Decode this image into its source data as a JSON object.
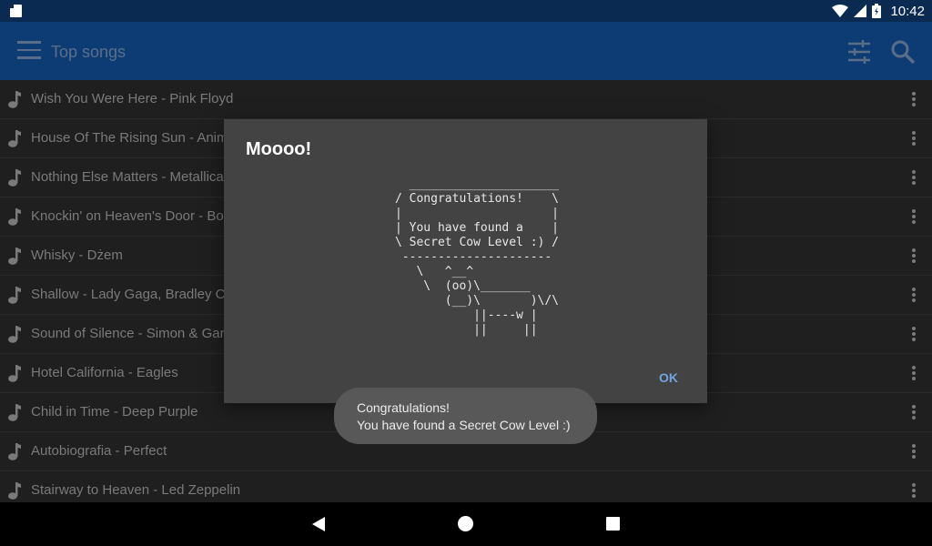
{
  "status_bar": {
    "time": "10:42"
  },
  "app_bar": {
    "title": "Top songs"
  },
  "songs": [
    "Wish You Were Here - Pink Floyd",
    "House Of The Rising Sun - Animals",
    "Nothing Else Matters - Metallica",
    "Knockin' on Heaven's Door - Bob Dylan",
    "Whisky - Dżem",
    "Shallow - Lady Gaga, Bradley Cooper",
    "Sound of Silence - Simon & Garfunkel",
    "Hotel California - Eagles",
    "Child in Time - Deep Purple",
    "Autobiografia - Perfect",
    "Stairway to Heaven - Led Zeppelin"
  ],
  "dialog": {
    "title": "Moooo!",
    "ascii_art": "  _____________________\n/ Congratulations!    \\\n|                     |\n| You have found a    |\n\\ Secret Cow Level :) /\n ---------------------\n   \\   ^__^\n    \\  (oo)\\_______\n       (__)\\       )\\/\\\n           ||----w |\n           ||     ||",
    "ok_label": "OK"
  },
  "toast": {
    "line1": "Congratulations!",
    "line2": "You have found a Secret Cow Level :)"
  },
  "colors": {
    "status_bar": "#0a2a52",
    "app_bar": "#0d3c74",
    "dialog_bg": "#434343",
    "accent": "#6fa4e0"
  }
}
